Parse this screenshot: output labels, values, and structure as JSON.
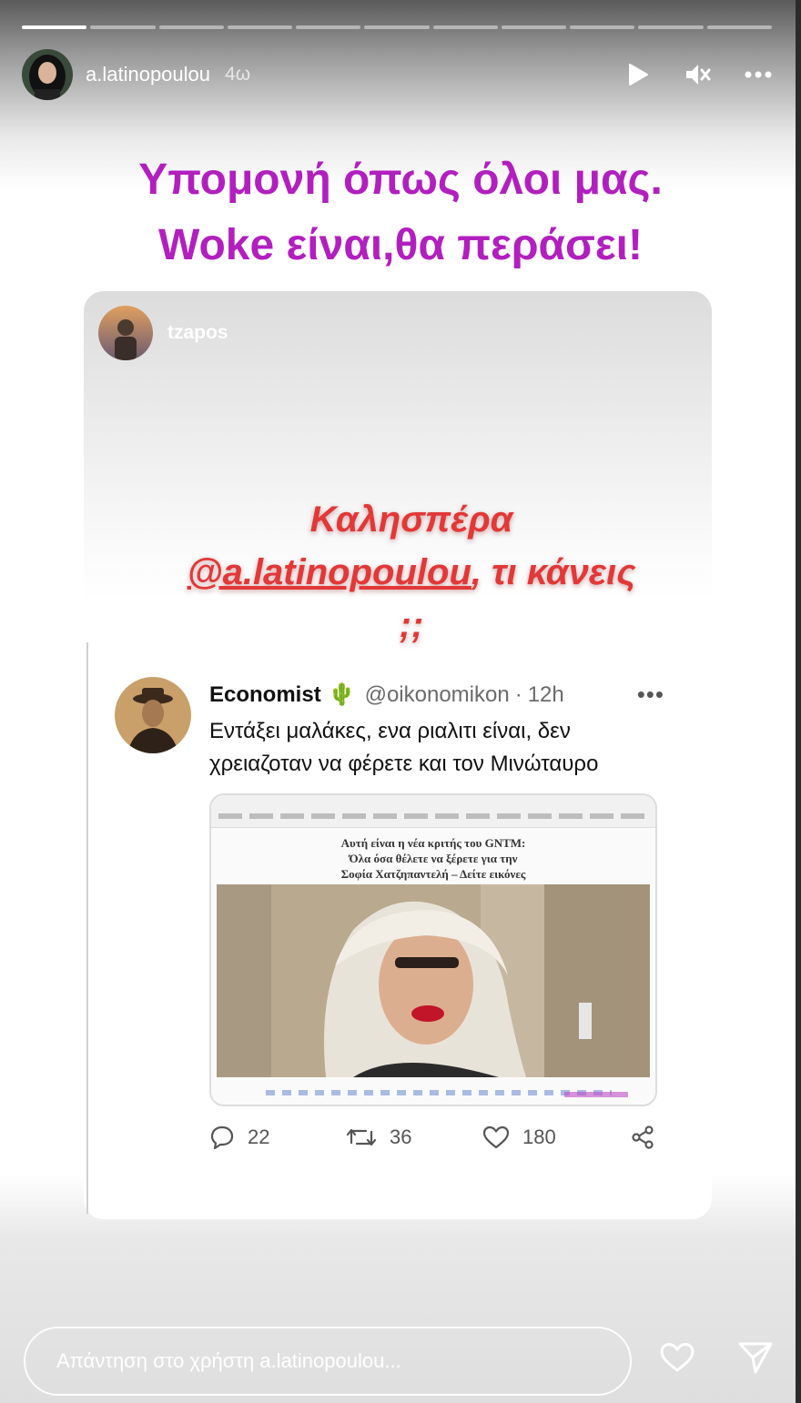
{
  "header": {
    "username": "a.latinopoulou",
    "time": "4ω",
    "progress": {
      "segments": 11,
      "active_index": 0
    },
    "icons": [
      "play-icon",
      "muted-icon",
      "more-icon"
    ]
  },
  "caption": {
    "line1": "Υπομονή όπως όλοι μας.",
    "line2": "Woke είναι,θα περάσει!"
  },
  "shared_story": {
    "username": "tzapos",
    "text_before": "Καλησπέρα ",
    "mention": "@a.latinopoulou",
    "text_after": ", τι κάνεις ;;"
  },
  "tweet": {
    "name": "Economist",
    "name_emoji": "🌵",
    "handle": "@oikonomikon",
    "separator": "·",
    "time": "12h",
    "more": "•••",
    "text": "Εντάξει μαλάκες, ενα ριαλιτι είναι, δεν χρειαζοταν να φέρετε και τον Μινώταυρο",
    "media": {
      "headline_1": "Αυτή είναι η νέα κριτής του GNTM:",
      "headline_2": "Όλα όσα θέλετε να ξέρετε για την",
      "headline_3": "Σοφία Χατζηπαντελή – Δείτε εικόνες"
    },
    "replies": "22",
    "retweets": "36",
    "likes": "180"
  },
  "reply_bar": {
    "placeholder": "Απάντηση στο χρήστη a.latinopoulou...",
    "icons": [
      "heart-icon",
      "send-icon"
    ]
  }
}
